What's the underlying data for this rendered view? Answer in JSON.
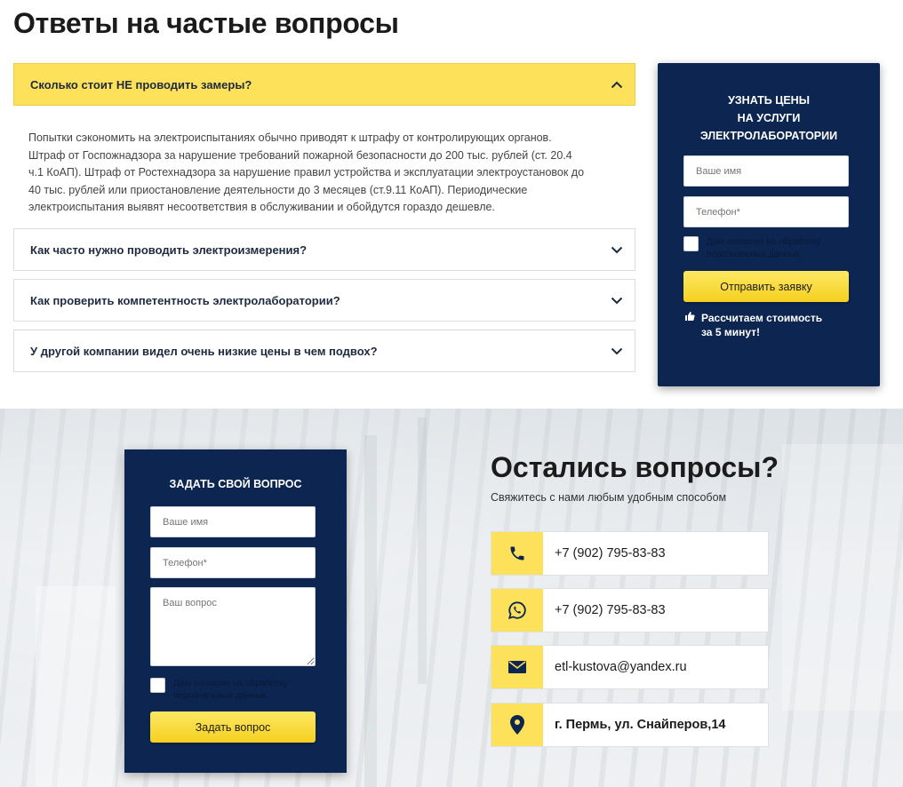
{
  "faq": {
    "title": "Ответы на частые вопросы",
    "items": [
      {
        "question": "Сколько стоит НЕ проводить замеры?",
        "open": true
      },
      {
        "question": "Как часто нужно проводить электроизмерения?",
        "open": false
      },
      {
        "question": "Как проверить компетентность электролаборатории?",
        "open": false
      },
      {
        "question": "У другой компании видел очень низкие цены в чем подвох?",
        "open": false
      }
    ],
    "answer_lines": [
      "Попытки сэкономить на электроиспытаниях обычно приводят к штрафу от контролирующих органов.",
      "Штраф от Госпожнадзора за нарушение требований пожарной безопасности до 200 тыс. рублей (ст. 20.4",
      "ч.1 КоАП). Штраф от Ростехнадзора за нарушение правил устройства и эксплуатации электроустановок до",
      "40 тыс. рублей или приостановление деятельности до 3 месяцев (ст.9.11 КоАП). Периодические",
      "электроиспытания выявят несоответствия в обслуживании и обойдутся гораздо дешевле."
    ]
  },
  "price_form": {
    "title_lines": [
      "УЗНАТЬ ЦЕНЫ",
      "НА УСЛУГИ",
      "ЭЛЕКТРОЛАБОРАТОРИИ"
    ],
    "name_placeholder": "Ваше имя",
    "phone_placeholder": "Телефон*",
    "consent_lines": [
      "Даю согласие на обработку",
      "персональных данных"
    ],
    "submit_label": "Отправить заявку",
    "promo_lines": [
      "Рассчитаем стоимость",
      "за 5 минут!"
    ]
  },
  "question_form": {
    "title": "ЗАДАТЬ СВОЙ ВОПРОС",
    "name_placeholder": "Ваше имя",
    "phone_placeholder": "Телефон*",
    "question_placeholder": "Ваш вопрос",
    "consent_lines": [
      "Даю согласие на обработку",
      "персональных данных"
    ],
    "submit_label": "Задать вопрос"
  },
  "contacts": {
    "title": "Остались вопросы?",
    "subtitle": "Свяжитесь с нами любым удобным способом",
    "items": [
      {
        "icon": "phone-icon",
        "text": "+7 (902) 795-83-83"
      },
      {
        "icon": "whatsapp-icon",
        "text": "+7 (902) 795-83-83"
      },
      {
        "icon": "email-icon",
        "text": "etl-kustova@yandex.ru"
      },
      {
        "icon": "location-pin-icon",
        "text": "г. Пермь, ул. Снайперов,14"
      }
    ]
  },
  "colors": {
    "navy": "#0c2551",
    "yellow": "#fde15a",
    "text_dark": "#1e2a3f"
  }
}
